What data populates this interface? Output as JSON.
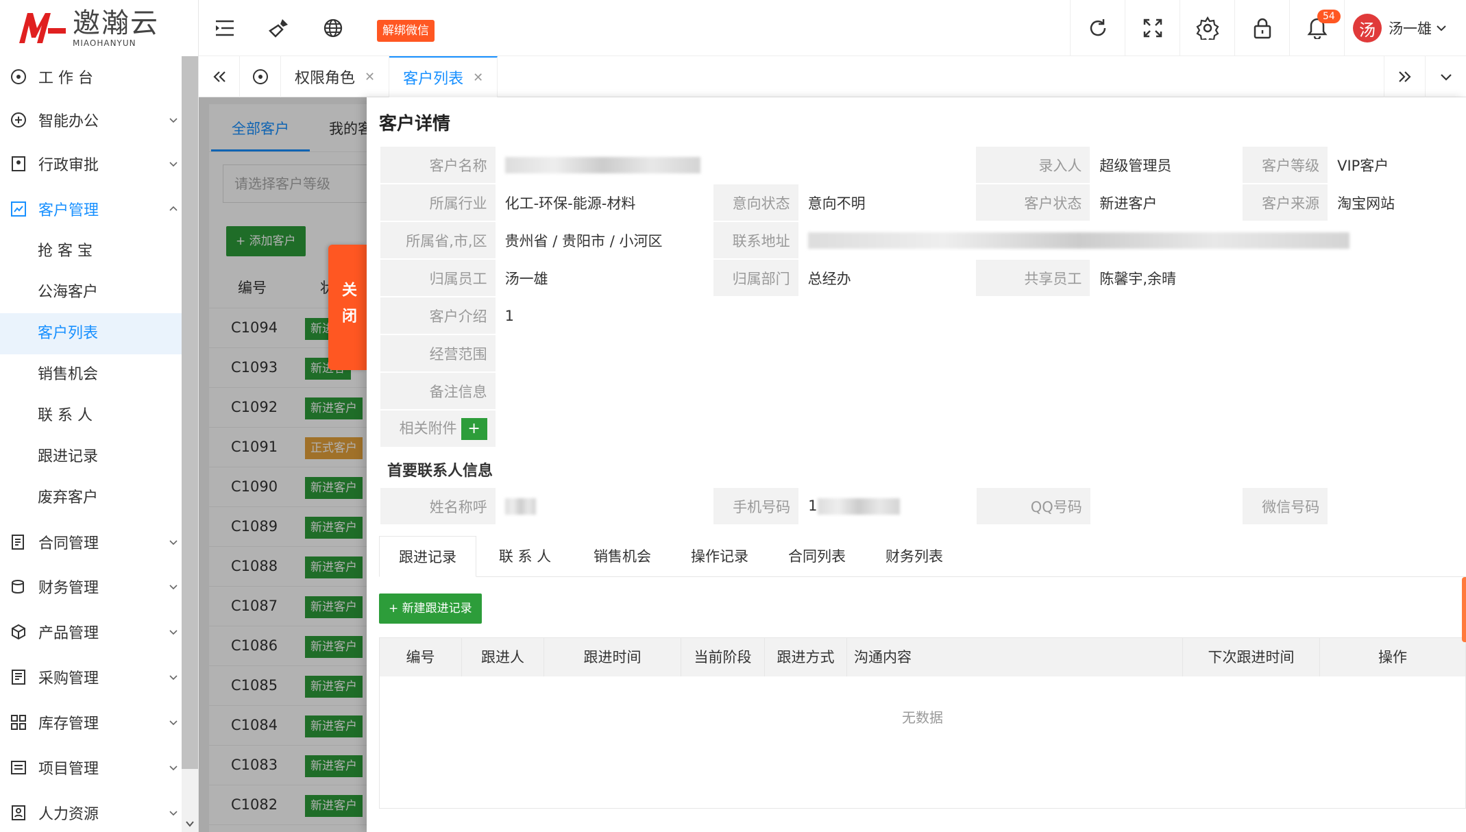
{
  "brand": {
    "name_cn": "邀瀚云",
    "name_en": "MIAOHANYUN"
  },
  "sidebar": {
    "items": [
      {
        "label": "工 作 台",
        "icon": "dashboard-icon"
      },
      {
        "label": "智能办公",
        "icon": "office-icon"
      },
      {
        "label": "行政审批",
        "icon": "approval-icon"
      },
      {
        "label": "客户管理",
        "icon": "customer-icon"
      },
      {
        "label": "抢 客 宝"
      },
      {
        "label": "公海客户"
      },
      {
        "label": "客户列表"
      },
      {
        "label": "销售机会"
      },
      {
        "label": "联 系 人"
      },
      {
        "label": "跟进记录"
      },
      {
        "label": "废弃客户"
      },
      {
        "label": "合同管理",
        "icon": "contract-icon"
      },
      {
        "label": "财务管理",
        "icon": "finance-icon"
      },
      {
        "label": "产品管理",
        "icon": "product-icon"
      },
      {
        "label": "采购管理",
        "icon": "purchase-icon"
      },
      {
        "label": "库存管理",
        "icon": "inventory-icon"
      },
      {
        "label": "项目管理",
        "icon": "project-icon"
      },
      {
        "label": "人力资源",
        "icon": "hr-icon"
      }
    ]
  },
  "topbar": {
    "wechat_button": "解绑微信",
    "notification_count": "54",
    "user_avatar": "汤",
    "user_name": "汤一雄"
  },
  "tabs": [
    {
      "label": "权限角色"
    },
    {
      "label": "客户列表"
    }
  ],
  "list": {
    "tabs": [
      "全部客户",
      "我的客"
    ],
    "select_placeholder": "请选择客户等级",
    "add_button": "+ 添加客户",
    "head": [
      "编号",
      "状"
    ],
    "rows": [
      {
        "code": "C1094",
        "status": "新进"
      },
      {
        "code": "C1093",
        "status": "新进客"
      },
      {
        "code": "C1092",
        "status": "新进客户"
      },
      {
        "code": "C1091",
        "status": "正式客户"
      },
      {
        "code": "C1090",
        "status": "新进客户"
      },
      {
        "code": "C1089",
        "status": "新进客户"
      },
      {
        "code": "C1088",
        "status": "新进客户"
      },
      {
        "code": "C1087",
        "status": "新进客户"
      },
      {
        "code": "C1086",
        "status": "新进客户"
      },
      {
        "code": "C1085",
        "status": "新进客户"
      },
      {
        "code": "C1084",
        "status": "新进客户"
      },
      {
        "code": "C1083",
        "status": "新进客户"
      },
      {
        "code": "C1082",
        "status": "新进客户"
      }
    ]
  },
  "close_label": "关闭",
  "detail": {
    "title": "客户详情",
    "labels": {
      "name": "客户名称",
      "entry_person": "录入人",
      "level": "客户等级",
      "industry": "所属行业",
      "intent_status": "意向状态",
      "customer_status": "客户状态",
      "source": "客户来源",
      "region": "所属省,市,区",
      "address": "联系地址",
      "owner": "归属员工",
      "department": "归属部门",
      "shared": "共享员工",
      "intro": "客户介绍",
      "scope": "经营范围",
      "remark": "备注信息",
      "attachments": "相关附件"
    },
    "values": {
      "entry_person": "超级管理员",
      "level": "VIP客户",
      "industry": "化工-环保-能源-材料",
      "intent_status": "意向不明",
      "customer_status": "新进客户",
      "source": "淘宝网站",
      "region": "贵州省 / 贵阳市 / 小河区",
      "owner": "汤一雄",
      "department": "总经办",
      "shared": "陈馨宇,余晴",
      "intro": "1"
    },
    "contact_section": "首要联系人信息",
    "contact_labels": {
      "name": "姓名称呼",
      "phone": "手机号码",
      "qq": "QQ号码",
      "wechat": "微信号码"
    },
    "phone_prefix": "1",
    "tabs": [
      "跟进记录",
      "联 系 人",
      "销售机会",
      "操作记录",
      "合同列表",
      "财务列表"
    ],
    "new_button": "+ 新建跟进记录",
    "table_head": [
      "编号",
      "跟进人",
      "跟进时间",
      "当前阶段",
      "跟进方式",
      "沟通内容",
      "下次跟进时间",
      "操作"
    ],
    "empty": "无数据"
  }
}
